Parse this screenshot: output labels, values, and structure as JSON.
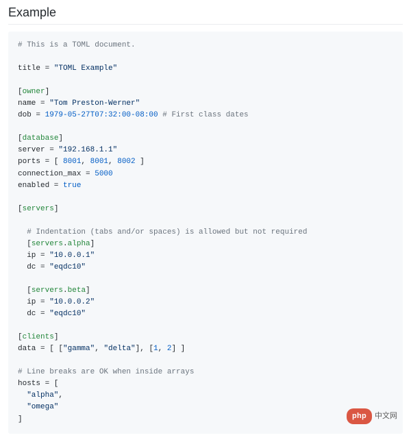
{
  "heading": "Example",
  "code": {
    "c1": "# This is a TOML document.",
    "l_title": "title = ",
    "v_title": "\"TOML Example\"",
    "sec_owner_l": "[",
    "sec_owner": "owner",
    "sec_owner_r": "]",
    "l_name": "name = ",
    "v_name": "\"Tom Preston-Werner\"",
    "l_dob": "dob = ",
    "v_dob": "1979-05-27T07:32:00-08:00",
    "c2": " # First class dates",
    "sec_db_l": "[",
    "sec_db": "database",
    "sec_db_r": "]",
    "l_server": "server = ",
    "v_server": "\"192.168.1.1\"",
    "l_ports": "ports = [ ",
    "v_p1": "8001",
    "sep1": ", ",
    "v_p2": "8001",
    "sep2": ", ",
    "v_p3": "8002",
    "l_ports_end": " ]",
    "l_cmax": "connection_max = ",
    "v_cmax": "5000",
    "l_enabled": "enabled = ",
    "v_enabled": "true",
    "sec_srv_l": "[",
    "sec_srv": "servers",
    "sec_srv_r": "]",
    "c3": "  # Indentation (tabs and/or spaces) is allowed but not required",
    "sec_a_l": "  [",
    "sec_a1": "servers",
    "sec_a_dot": ".",
    "sec_a2": "alpha",
    "sec_a_r": "]",
    "l_ip_a": "  ip = ",
    "v_ip_a": "\"10.0.0.1\"",
    "l_dc_a": "  dc = ",
    "v_dc_a": "\"eqdc10\"",
    "sec_b_l": "  [",
    "sec_b1": "servers",
    "sec_b_dot": ".",
    "sec_b2": "beta",
    "sec_b_r": "]",
    "l_ip_b": "  ip = ",
    "v_ip_b": "\"10.0.0.2\"",
    "l_dc_b": "  dc = ",
    "v_dc_b": "\"eqdc10\"",
    "sec_cl_l": "[",
    "sec_cl": "clients",
    "sec_cl_r": "]",
    "l_data": "data = [ [",
    "v_g": "\"gamma\"",
    "sep3": ", ",
    "v_d": "\"delta\"",
    "l_data_m": "], [",
    "v_1": "1",
    "sep4": ", ",
    "v_2": "2",
    "l_data_e": "] ]",
    "c4": "# Line breaks are OK when inside arrays",
    "l_hosts": "hosts = [",
    "v_alpha": "\"alpha\"",
    "l_a_ind": "  ",
    "l_a_end": ",",
    "l_o_ind": "  ",
    "v_omega": "\"omega\"",
    "l_hosts_e": "]"
  },
  "watermark": {
    "pill": "php",
    "text": "中文网"
  }
}
